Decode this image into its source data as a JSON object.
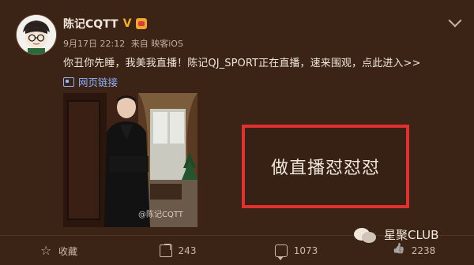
{
  "post": {
    "username": "陈记CQTT",
    "verified_badge": "V",
    "date": "9月17日 22:12",
    "source_prefix": "来自",
    "source": "映客iOS",
    "text": "你丑你先睡，我美我直播！陈记QJ_SPORT正在直播，速来围观，点此进入>>",
    "web_link_label": "网页链接",
    "image_watermark": "@陈记CQTT"
  },
  "callout": {
    "text": "做直播怼怼怼",
    "border_color": "#e0302f"
  },
  "actions": [
    {
      "label": "收藏",
      "icon": "star-icon"
    },
    {
      "label": "243",
      "icon": "share-icon"
    },
    {
      "label": "1073",
      "icon": "comment-icon"
    },
    {
      "label": "2238",
      "icon": "like-icon"
    }
  ],
  "branding": {
    "text": "星聚CLUB",
    "icon": "wechat-icon"
  },
  "colors": {
    "background": "#3b2416",
    "link": "#8fb3ff",
    "verified": "#f2b21b"
  }
}
